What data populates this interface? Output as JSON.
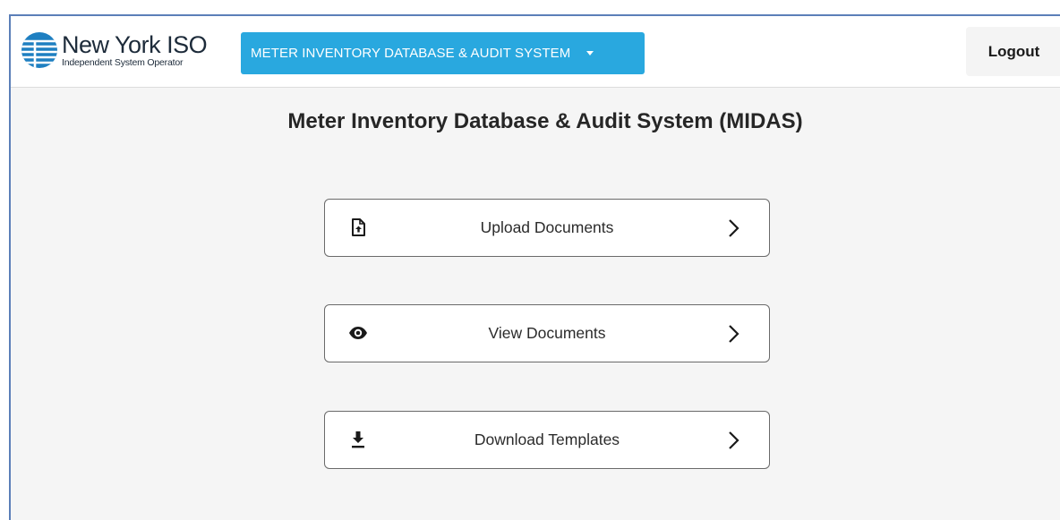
{
  "header": {
    "logo": {
      "name": "New York ISO",
      "subtitle": "Independent System Operator",
      "icon": "nyiso-globe-icon"
    },
    "app_menu": {
      "label": "METER INVENTORY DATABASE & AUDIT SYSTEM",
      "icon": "caret-down-icon"
    },
    "logout_label": "Logout"
  },
  "main": {
    "title": "Meter Inventory Database & Audit System (MIDAS)",
    "actions": [
      {
        "label": "Upload Documents",
        "icon": "file-upload-icon"
      },
      {
        "label": "View Documents",
        "icon": "eye-icon"
      },
      {
        "label": "Download Templates",
        "icon": "download-icon"
      }
    ]
  },
  "colors": {
    "accent": "#29a8df",
    "frame_border": "#5b7fb8",
    "logo_blue": "#1e7fc1",
    "page_background": "#f5f5f5"
  }
}
